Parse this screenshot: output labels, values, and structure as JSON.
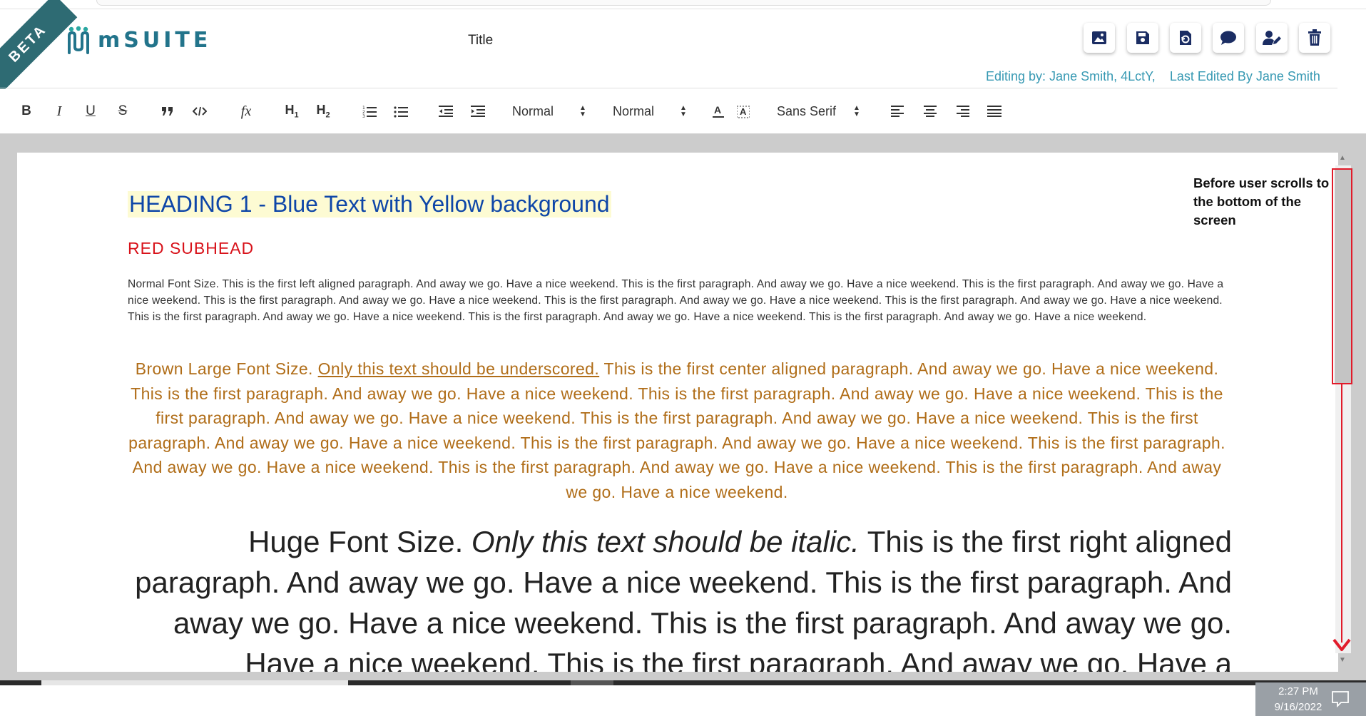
{
  "app": {
    "beta_label": "BETA",
    "logo_text": "mSUITE",
    "document_title": "Title",
    "accent_color": "#22748b"
  },
  "header": {
    "editing_by": "Editing by: Jane Smith, 4LctY,",
    "last_edited_by": "Last Edited By Jane Smith",
    "actions": [
      {
        "icon": "image-icon",
        "label": "Insert image"
      },
      {
        "icon": "save-icon",
        "label": "Save"
      },
      {
        "icon": "history-icon",
        "label": "Revert"
      },
      {
        "icon": "comment-icon",
        "label": "Comments"
      },
      {
        "icon": "user-edit-icon",
        "label": "Share"
      },
      {
        "icon": "trash-icon",
        "label": "Delete"
      }
    ]
  },
  "toolbar": {
    "heading_select": "Normal",
    "size_select": "Normal",
    "font_select": "Sans Serif",
    "h1_label": "H",
    "h2_label": "H"
  },
  "document": {
    "heading1": "HEADING 1 - Blue Text with Yellow background",
    "subhead": "RED SUBHEAD",
    "normal_paragraph": "Normal Font Size. This is the first left aligned paragraph. And away we go. Have a nice weekend. This is the first paragraph. And away we go. Have a nice weekend. This is the first paragraph. And away we go. Have a nice weekend. This is the first paragraph. And away we go. Have a nice weekend. This is the first paragraph. And away we go. Have a nice weekend. This is the first paragraph. And away we go. Have a nice weekend. This is the first paragraph. And away we go. Have a nice weekend. This is the first paragraph. And away we go. Have a nice weekend. This is the first paragraph. And away we go. Have a nice weekend.",
    "brown_lead": "Brown Large Font Size. ",
    "brown_underlined": "Only this text should be underscored.",
    "brown_rest": " This is the first center aligned paragraph. And away we go. Have a nice weekend. This is the first paragraph. And away we go. Have a nice weekend. This is the first paragraph. And away we go. Have a nice weekend. This is the first paragraph. And away we go. Have a nice weekend. This is the first paragraph. And away we go. Have a nice weekend. This is the first paragraph. And away we go. Have a nice weekend. This is the first paragraph. And away we go. Have a nice weekend. This is the first paragraph. And away we go. Have a nice weekend. This is the first paragraph. And away we go. Have a nice weekend. This is the first paragraph. And away we go. Have a nice weekend.",
    "huge_lead": "Huge Font Size. ",
    "huge_italic": "Only this text should be italic.",
    "huge_rest": " This is the first right aligned paragraph. And away we go. Have a nice weekend. This is the first paragraph. And away we go. Have a nice weekend. This is the first paragraph. And away we go. Have a nice weekend. This is the first paragraph. And away we go. Have a"
  },
  "annotation": {
    "note": "Before user scrolls to the bottom of the screen",
    "highlight_color": "#e11b2a"
  },
  "system_tray": {
    "time": "2:27 PM",
    "date": "9/16/2022"
  }
}
